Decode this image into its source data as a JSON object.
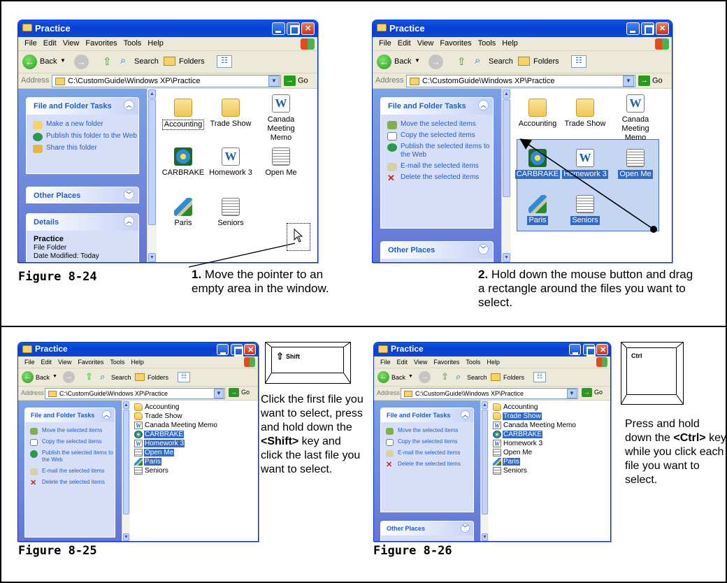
{
  "captions": {
    "fig24": "Figure 8-24",
    "fig25": "Figure 8-25",
    "fig26": "Figure 8-26"
  },
  "steps": {
    "step1_num": "1.",
    "step1_text": "Move the pointer to an empty area in the window.",
    "step2_num": "2.",
    "step2_text": "Hold down the mouse button and drag a rectangle around the files you want to select."
  },
  "text_shift": {
    "before": "Click the first file you want to select, press and hold down the ",
    "key": "<Shift>",
    "after": " key and click the last file you want to select."
  },
  "text_ctrl": {
    "before": "Press and hold down the ",
    "key": "<Ctrl>",
    "after": " key while you click each file you want to select."
  },
  "keys": {
    "shift": "Shift",
    "shift_symbol": "⇧",
    "ctrl": "Ctrl"
  },
  "window": {
    "title": "Practice",
    "menu": [
      "File",
      "Edit",
      "View",
      "Favorites",
      "Tools",
      "Help"
    ],
    "toolbar": {
      "back": "Back",
      "search": "Search",
      "folders": "Folders"
    },
    "address_label": "Address",
    "address_value": "C:\\CustomGuide\\Windows XP\\Practice",
    "go": "Go"
  },
  "panels": {
    "file_tasks_title": "File and Folder Tasks",
    "other_places": "Other Places",
    "details": "Details",
    "tasks_folder": [
      "Make a new folder",
      "Publish this folder to the Web",
      "Share this folder"
    ],
    "tasks_selected": [
      "Move the selected items",
      "Copy the selected items",
      "Publish the selected items to the Web",
      "E-mail the selected items",
      "Delete the selected items"
    ],
    "details_name": "Practice",
    "details_type": "File Folder",
    "details_modified": "Date Modified: Today"
  },
  "files": [
    "Accounting",
    "Trade Show",
    "Canada Meeting Memo",
    "CARBRAKE",
    "Homework 3",
    "Open Me",
    "Paris",
    "Seniors"
  ],
  "list_files": [
    "Accounting",
    "Trade Show",
    "Canada Meeting Memo",
    "CARBRAKE",
    "Homework 3",
    "Open Me",
    "Paris",
    "Seniors"
  ],
  "icons": {
    "folder": "folder-icon",
    "word": "word-document-icon",
    "text": "text-document-icon",
    "media": "media-file-icon",
    "paint": "paint-image-icon",
    "word_glyph": "W"
  },
  "colors": {
    "selection": "#316ac5",
    "titlebar": "#0a50e0",
    "task_pane": "#6f8fe0"
  }
}
